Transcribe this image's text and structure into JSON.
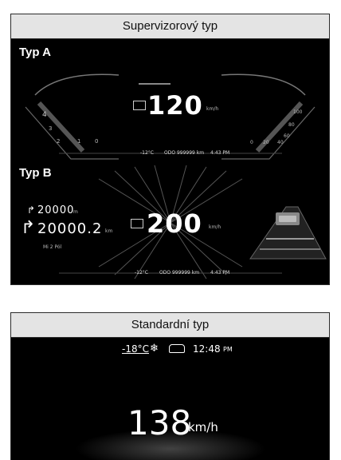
{
  "supervisor": {
    "header": "Supervizorový typ",
    "typeA": {
      "label": "Typ A",
      "speed": "120",
      "speed_unit": "km/h",
      "gear_left": [
        "4",
        "3",
        "2",
        "1",
        "0"
      ],
      "gauge_right": [
        "100",
        "80",
        "60",
        "40",
        "20",
        "0"
      ],
      "odometer": "ODO 999999 km",
      "temperature": "-12°C",
      "clock": "4:43 PM"
    },
    "typeB": {
      "label": "Typ B",
      "speed": "200",
      "speed_unit": "km/h",
      "nav_small": "20000",
      "nav_small_unit": "m",
      "nav_large": "20000.2",
      "nav_large_unit": "km",
      "nav_note": "Mi 2 Pól",
      "odometer": "ODO 999999 km",
      "temperature": "-12°C",
      "clock": "4:43 PM"
    }
  },
  "standard": {
    "header": "Standardní typ",
    "temperature": "-18°C",
    "clock": "12:48",
    "clock_suffix": "PM",
    "speed": "138",
    "speed_unit": "km/h"
  },
  "icons": {
    "snowflake": "snowflake-icon",
    "car": "car-icon",
    "turn_arrow": "turn-right-arrow-icon",
    "display_mode": "display-mode-icon"
  },
  "colors": {
    "panel_bg": "#000000",
    "header_bg": "#e4e4e4",
    "text": "#ffffff"
  }
}
